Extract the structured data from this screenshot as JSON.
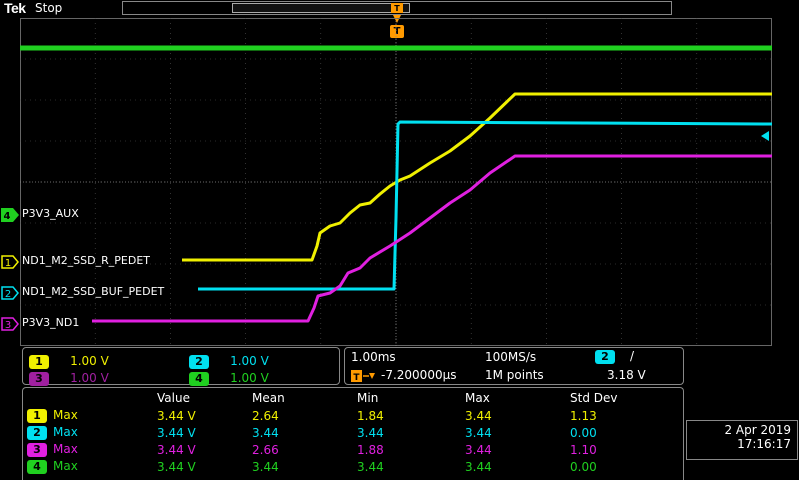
{
  "header": {
    "brand": "Tek",
    "status": "Stop"
  },
  "trigger": {
    "marker": "T"
  },
  "channels": [
    {
      "num": "1",
      "name": "ND1_M2_SSD_R_PEDET",
      "color": "#f0f000",
      "scale": "1.00 V"
    },
    {
      "num": "2",
      "name": "ND1_M2_SSD_BUF_PEDET",
      "color": "#00e0f0",
      "scale": "1.00 V"
    },
    {
      "num": "3",
      "name": "P3V3_ND1",
      "color": "#e020e0",
      "scale": "1.00 V"
    },
    {
      "num": "4",
      "name": "P3V3_AUX",
      "color": "#20d020",
      "scale": "1.00 V"
    }
  ],
  "timebase": {
    "scale": "1.00ms",
    "sample_rate": "100MS/s",
    "position": "-7.200000µs",
    "record_length": "1M points",
    "trigger_channel": "2",
    "trigger_slope": "/",
    "trigger_level": "3.18 V"
  },
  "measurements": {
    "headers": [
      "Value",
      "Mean",
      "Min",
      "Max",
      "Std Dev"
    ],
    "rows": [
      {
        "ch": "1",
        "type": "Max",
        "color": "#f0f000",
        "value": "3.44 V",
        "mean": "2.64",
        "min": "1.84",
        "max": "3.44",
        "std": "1.13"
      },
      {
        "ch": "2",
        "type": "Max",
        "color": "#00e0f0",
        "value": "3.44 V",
        "mean": "3.44",
        "min": "3.44",
        "max": "3.44",
        "std": "0.00"
      },
      {
        "ch": "3",
        "type": "Max",
        "color": "#e020e0",
        "value": "3.44 V",
        "mean": "2.66",
        "min": "1.88",
        "max": "3.44",
        "std": "1.10"
      },
      {
        "ch": "4",
        "type": "Max",
        "color": "#20d020",
        "value": "3.44 V",
        "mean": "3.44",
        "min": "3.44",
        "max": "3.44",
        "std": "0.00"
      }
    ]
  },
  "datetime": {
    "date": "2 Apr  2019",
    "time": "17:16:17"
  }
}
